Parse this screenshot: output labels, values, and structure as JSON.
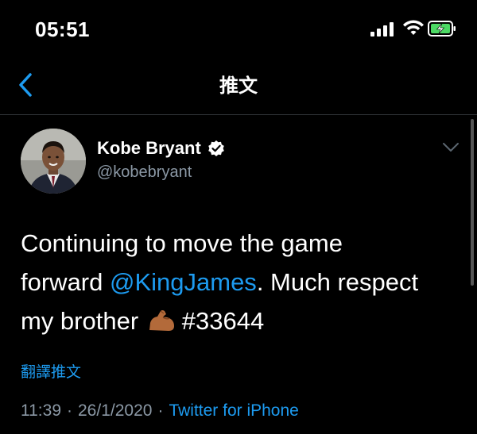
{
  "status_bar": {
    "time": "05:51"
  },
  "nav": {
    "title": "推文"
  },
  "author": {
    "name": "Kobe Bryant",
    "handle": "@kobebryant"
  },
  "tweet": {
    "line1": "Continuing to move the game",
    "line2_prefix": "forward ",
    "mention": "@KingJames",
    "line2_suffix": ". Much respect",
    "line3_prefix": "my brother",
    "hashtag": "#33644",
    "emoji": "flexed-biceps-icon"
  },
  "translate_label": "翻譯推文",
  "meta": {
    "time": "11:39",
    "separator": "·",
    "date": "26/1/2020",
    "source": "Twitter for iPhone"
  },
  "colors": {
    "link": "#1d9bf0",
    "muted": "#8b98a5",
    "battery": "#4cd964"
  }
}
